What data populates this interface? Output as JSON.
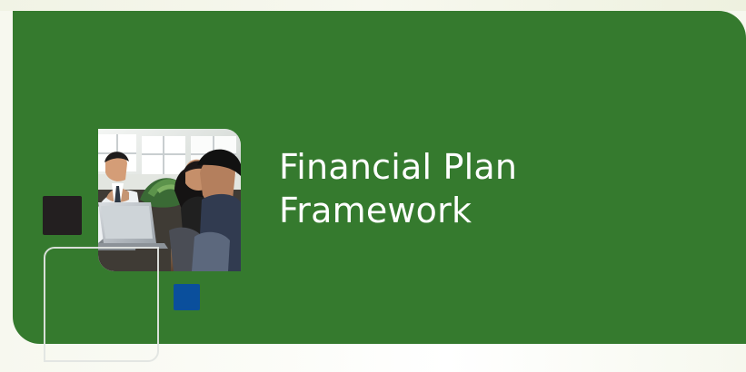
{
  "cover": {
    "title_line_1": "Financial Plan",
    "title_line_2": "Framework"
  },
  "colors": {
    "banner_green": "#357a2e",
    "title_text": "#ffffff",
    "dark_square": "#231f20",
    "blue_square": "#0a4f9c",
    "outline_square": "#e1e5e2"
  },
  "photo": {
    "subject": "three people reviewing a laptop together"
  }
}
